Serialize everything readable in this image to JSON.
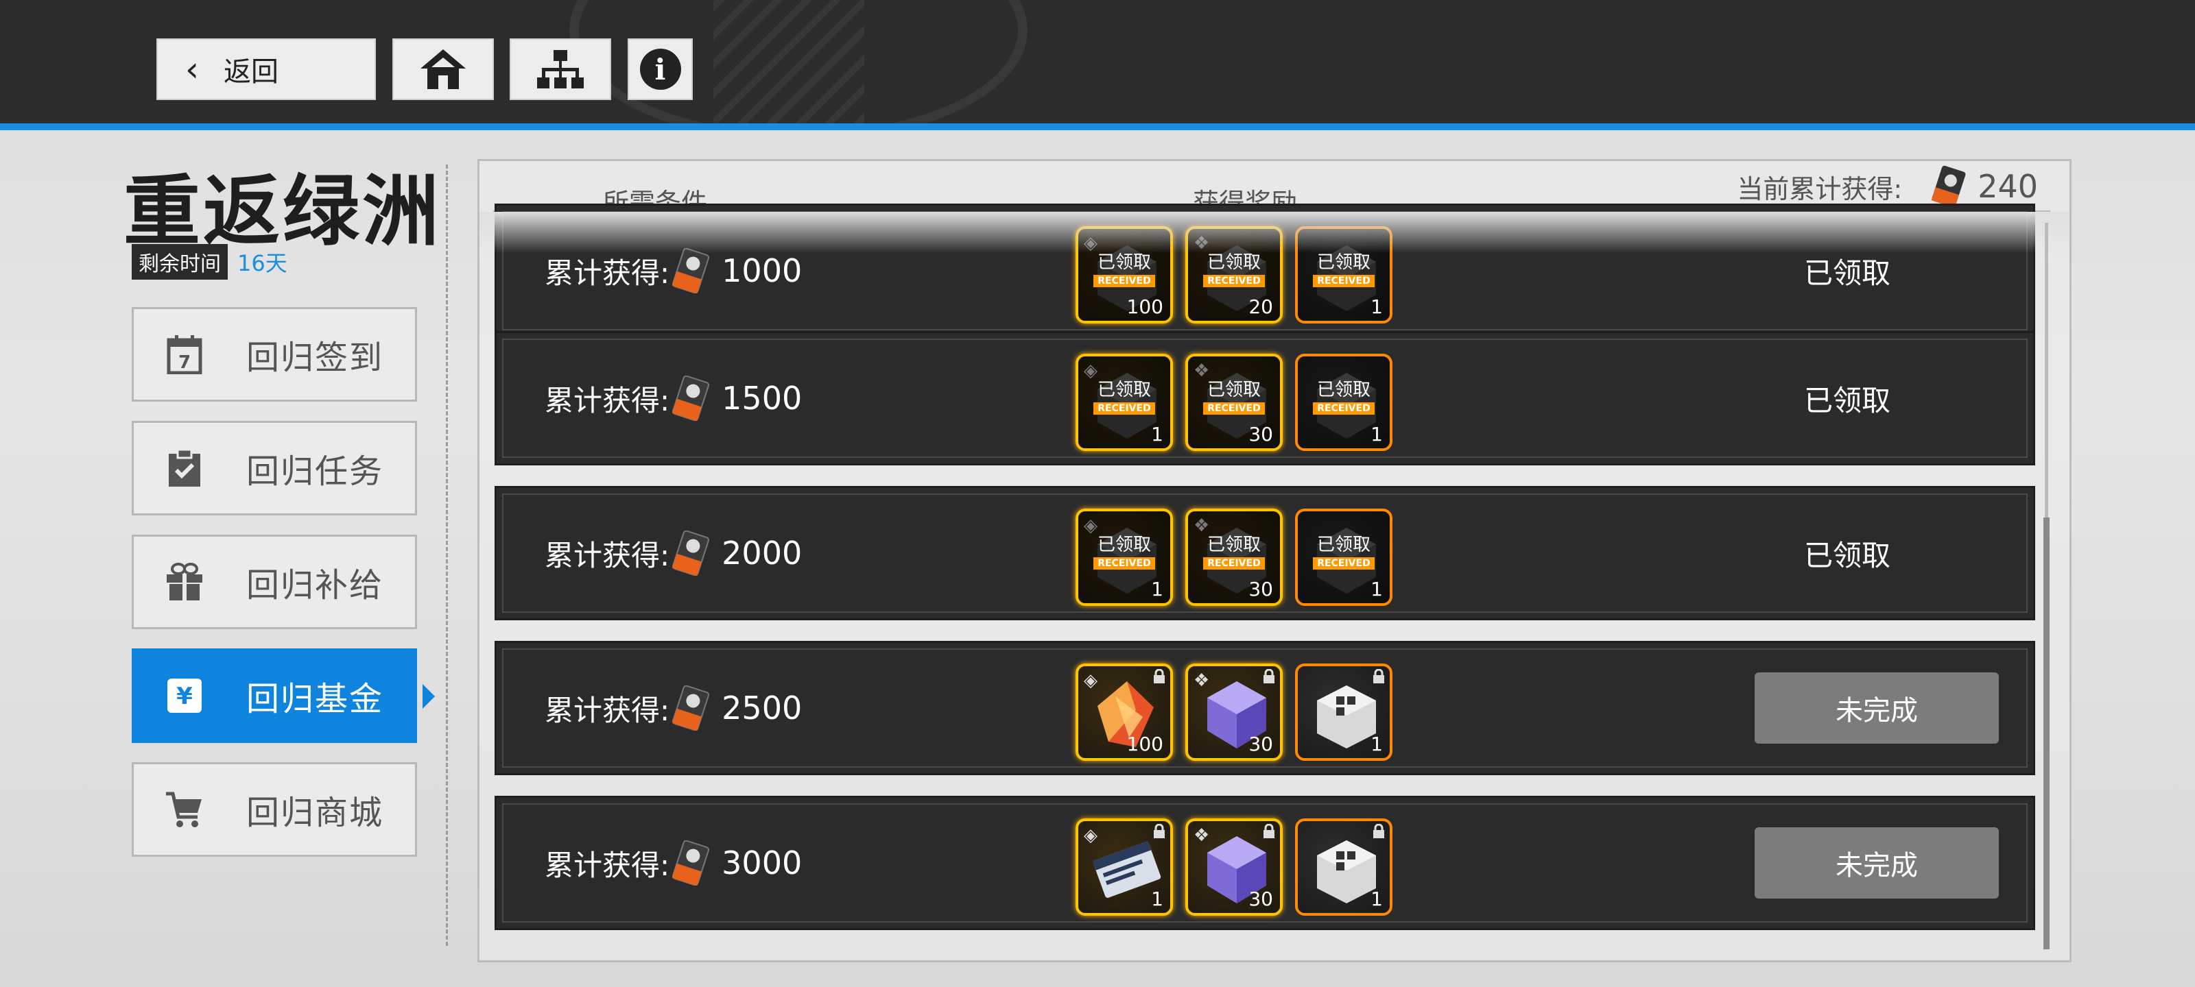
{
  "nav": {
    "back_label": "返回",
    "home_icon": "home-icon",
    "tree_icon": "sitemap-icon",
    "info_icon": "info-icon"
  },
  "event": {
    "title": "重返绿洲",
    "remaining_label": "剩余时间",
    "remaining_value": "16天"
  },
  "sidebar": {
    "items": [
      {
        "label": "回归签到",
        "icon": "calendar-icon",
        "active": false
      },
      {
        "label": "回归任务",
        "icon": "clipboard-check-icon",
        "active": false
      },
      {
        "label": "回归补给",
        "icon": "gift-icon",
        "active": false
      },
      {
        "label": "回归基金",
        "icon": "yen-icon",
        "active": true
      },
      {
        "label": "回归商城",
        "icon": "shopping-cart-icon",
        "active": false
      }
    ]
  },
  "header": {
    "condition_label": "所需条件",
    "reward_label": "获得奖励",
    "total_label": "当前累计获得:",
    "total_value": "240"
  },
  "rows": [
    {
      "cond_label": "累计获得:",
      "cond_value": "1000",
      "status": "已领取",
      "rewards": [
        {
          "qty": "100",
          "received_zh": "已领取",
          "received_en": "RECEIVED",
          "frame": "gold"
        },
        {
          "qty": "20",
          "received_zh": "已领取",
          "received_en": "RECEIVED",
          "frame": "gold"
        },
        {
          "qty": "1",
          "received_zh": "已领取",
          "received_en": "RECEIVED",
          "frame": "orange"
        }
      ]
    },
    {
      "cond_label": "累计获得:",
      "cond_value": "1500",
      "status": "已领取",
      "rewards": [
        {
          "qty": "1",
          "received_zh": "已领取",
          "received_en": "RECEIVED",
          "frame": "gold"
        },
        {
          "qty": "30",
          "received_zh": "已领取",
          "received_en": "RECEIVED",
          "frame": "gold"
        },
        {
          "qty": "1",
          "received_zh": "已领取",
          "received_en": "RECEIVED",
          "frame": "orange"
        }
      ]
    },
    {
      "cond_label": "累计获得:",
      "cond_value": "2000",
      "status": "已领取",
      "rewards": [
        {
          "qty": "1",
          "received_zh": "已领取",
          "received_en": "RECEIVED",
          "frame": "gold"
        },
        {
          "qty": "30",
          "received_zh": "已领取",
          "received_en": "RECEIVED",
          "frame": "gold"
        },
        {
          "qty": "1",
          "received_zh": "已领取",
          "received_en": "RECEIVED",
          "frame": "orange"
        }
      ]
    },
    {
      "cond_label": "累计获得:",
      "cond_value": "2500",
      "status": "未完成",
      "rewards": [
        {
          "qty": "100",
          "frame": "gold",
          "art": "red-crystal"
        },
        {
          "qty": "30",
          "frame": "gold",
          "art": "purple-cube"
        },
        {
          "qty": "1",
          "frame": "orange",
          "art": "white-box"
        }
      ]
    },
    {
      "cond_label": "累计获得:",
      "cond_value": "3000",
      "status": "未完成",
      "rewards": [
        {
          "qty": "1",
          "frame": "gold",
          "art": "ticket-card"
        },
        {
          "qty": "30",
          "frame": "gold",
          "art": "purple-cube"
        },
        {
          "qty": "1",
          "frame": "orange",
          "art": "white-box"
        }
      ]
    }
  ],
  "colors": {
    "accent": "#0f84de",
    "gold": "#ffc400",
    "orange": "#ff8a00"
  }
}
